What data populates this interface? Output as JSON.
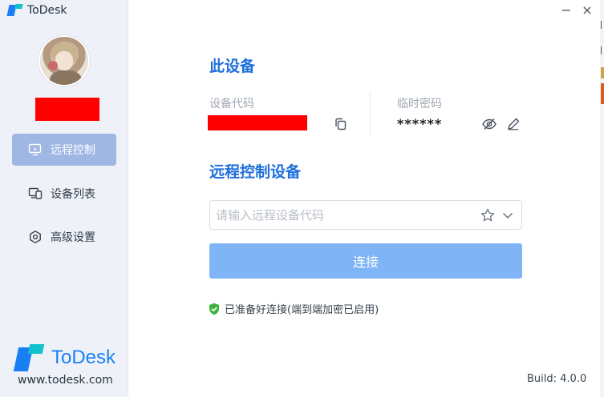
{
  "app": {
    "title": "ToDesk",
    "brand_name": "ToDesk",
    "website": "www.todesk.com",
    "build": "Build: 4.0.0",
    "accent_color": "#1a7ff5",
    "secondary_color": "#12c1c9",
    "active_nav_color": "#9fb7e3",
    "button_color": "#7fb5f7",
    "redaction_color": "#ff0000"
  },
  "window_controls": {
    "minimize": "−",
    "close": "×"
  },
  "sidebar": {
    "items": [
      {
        "label": "远程控制",
        "icon": "remote-control-icon",
        "active": true
      },
      {
        "label": "设备列表",
        "icon": "device-list-icon",
        "active": false
      },
      {
        "label": "高级设置",
        "icon": "settings-icon",
        "active": false
      }
    ]
  },
  "this_device": {
    "title": "此设备",
    "code_label": "设备代码",
    "password_label": "临时密码",
    "password_value": "******"
  },
  "remote": {
    "title": "远程控制设备",
    "input_placeholder": "请输入远程设备代码",
    "connect_label": "连接"
  },
  "status": {
    "text": "已准备好连接(端到端加密已启用)",
    "color": "#3cb33c"
  }
}
